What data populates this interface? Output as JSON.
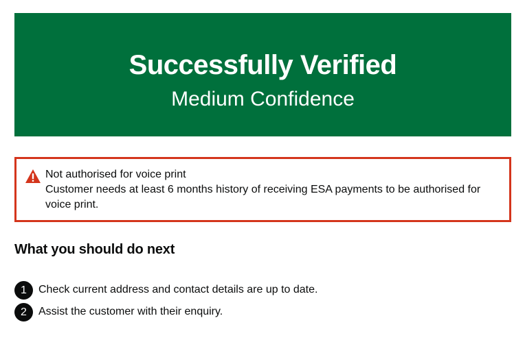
{
  "confirmation_panel": {
    "title": "Successfully Verified",
    "body": "Medium Confidence",
    "background_color": "#00703c"
  },
  "warning": {
    "icon": "warning-triangle-icon",
    "border_color": "#d4351c",
    "title": "Not authorised for voice print",
    "message": "Customer needs at least 6 months history of receiving ESA payments to be authorised for voice print."
  },
  "next_steps": {
    "heading": "What you should do next",
    "steps": [
      {
        "number": "1",
        "text": "Check current address and contact details are up to date."
      },
      {
        "number": "2",
        "text": "Assist the customer with their enquiry."
      }
    ]
  }
}
